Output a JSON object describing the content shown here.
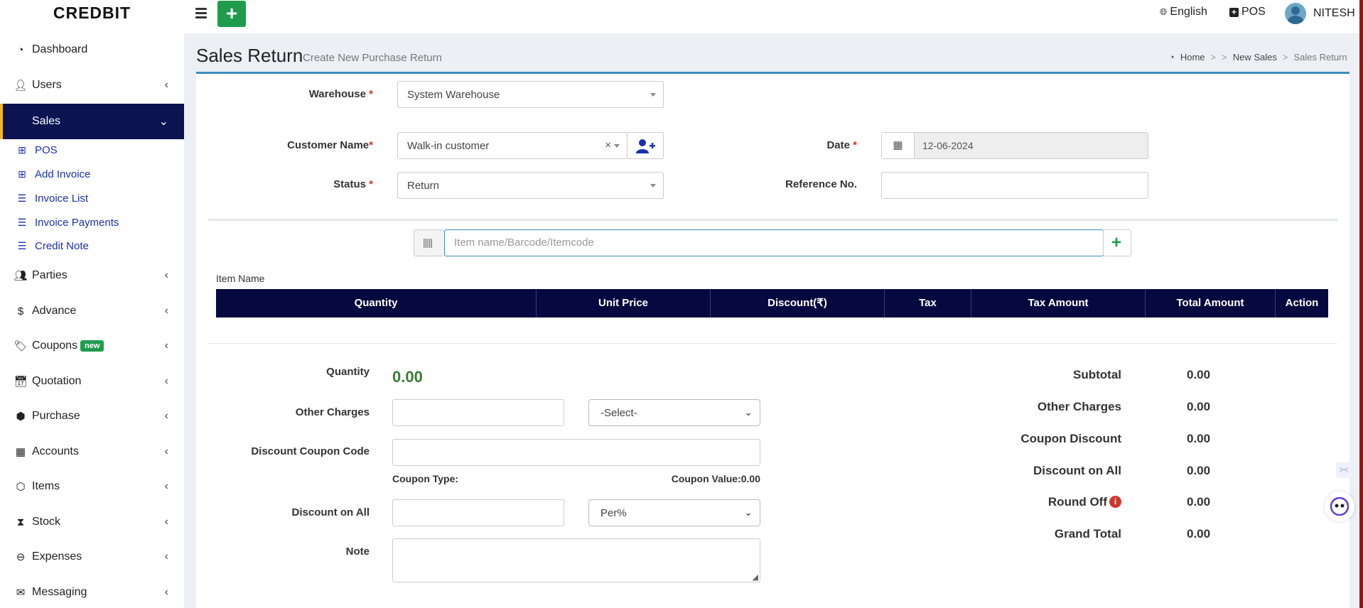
{
  "brand": "CREDBIT",
  "topbar": {
    "language": "English",
    "pos": "POS",
    "user": "NITESH"
  },
  "sidebar": {
    "items": [
      {
        "label": "Dashboard",
        "icon": "dashboard-icon"
      },
      {
        "label": "Users",
        "icon": "user-plus-icon"
      },
      {
        "label": "Sales",
        "icon": "",
        "active": true
      },
      {
        "label": "Parties",
        "icon": "users-icon"
      },
      {
        "label": "Advance",
        "icon": "dollar-icon"
      },
      {
        "label": "Coupons",
        "icon": "tags-icon",
        "badge": "new"
      },
      {
        "label": "Quotation",
        "icon": "calendar-plus-icon"
      },
      {
        "label": "Purchase",
        "icon": "cube-icon"
      },
      {
        "label": "Accounts",
        "icon": "grid-icon"
      },
      {
        "label": "Items",
        "icon": "cubes-icon"
      },
      {
        "label": "Stock",
        "icon": "hourglass-icon"
      },
      {
        "label": "Expenses",
        "icon": "minus-circle-icon"
      },
      {
        "label": "Messaging",
        "icon": "envelope-icon"
      }
    ],
    "sales_sub": [
      "POS",
      "Add Invoice",
      "Invoice List",
      "Invoice Payments",
      "Credit Note"
    ]
  },
  "page": {
    "title": "Sales Return",
    "subtitle": "Create New Purchase Return",
    "breadcrumb": [
      "Home",
      ">",
      ">",
      "New Sales",
      ">",
      "Sales Return"
    ]
  },
  "form": {
    "warehouse_label": "Warehouse",
    "warehouse_value": "System Warehouse",
    "customer_label": "Customer Name",
    "customer_value": "Walk-in customer",
    "status_label": "Status",
    "status_value": "Return",
    "date_label": "Date",
    "date_value": "12-06-2024",
    "reference_label": "Reference No.",
    "reference_value": "",
    "required_mark": "*",
    "item_search_placeholder": "Item name/Barcode/Itemcode"
  },
  "table": {
    "caption": "Item Name",
    "columns": [
      "Quantity",
      "Unit Price",
      "Discount(₹)",
      "Tax",
      "Tax Amount",
      "Total Amount",
      "Action"
    ],
    "rows": []
  },
  "footer_form": {
    "quantity_label": "Quantity",
    "quantity_value": "0.00",
    "other_charges_label": "Other Charges",
    "other_charges_select": "-Select-",
    "coupon_code_label": "Discount Coupon Code",
    "coupon_type_label": "Coupon Type:",
    "coupon_value_label": "Coupon Value:0.00",
    "discount_all_label": "Discount on All",
    "discount_type": "Per%",
    "note_label": "Note"
  },
  "summary": [
    {
      "label": "Subtotal",
      "value": "0.00"
    },
    {
      "label": "Other Charges",
      "value": "0.00"
    },
    {
      "label": "Coupon Discount",
      "value": "0.00"
    },
    {
      "label": "Discount on All",
      "value": "0.00"
    },
    {
      "label": "Round Off",
      "value": "0.00",
      "info": true
    },
    {
      "label": "Grand Total",
      "value": "0.00"
    }
  ],
  "colors": {
    "sidebar_active_bg": "#0b1450",
    "table_header_bg": "#06093f",
    "accent_green": "#1e9c4c",
    "quantity_green": "#3a7d34",
    "link_blue": "#1a2fb0"
  }
}
